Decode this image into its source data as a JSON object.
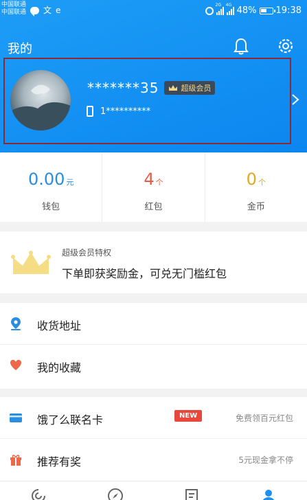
{
  "status_bar": {
    "carrier_1": "中国联通",
    "carrier_2": "中国联通",
    "net_tag_1": "2G",
    "net_tag_2": "4G",
    "battery": "48%",
    "time": "19:38"
  },
  "header": {
    "title": "我的",
    "icons": [
      "bell-icon",
      "settings-icon"
    ]
  },
  "profile": {
    "username": "*******35",
    "vip_badge": "超级会员",
    "phone": "1**********"
  },
  "stats": [
    {
      "value": "0.00",
      "unit": "元",
      "label": "钱包",
      "color": "#2a8de0"
    },
    {
      "value": "4",
      "unit": "个",
      "label": "红包",
      "color": "#e35e4a"
    },
    {
      "value": "0",
      "unit": "个",
      "label": "金币",
      "color": "#e2a820"
    }
  ],
  "vip_card": {
    "title": "超级会员特权",
    "desc": "下单即获奖励金，可兑无门槛红包"
  },
  "list_a": [
    {
      "label": "收货地址",
      "icon": "location-pin-icon"
    },
    {
      "label": "我的收藏",
      "icon": "heart-icon"
    }
  ],
  "list_b": [
    {
      "label": "饿了么联名卡",
      "badge": "NEW",
      "right": "免费领百元红包",
      "icon": "card-icon"
    },
    {
      "label": "推荐有奖",
      "right": "5元现金拿不停",
      "icon": "gift-icon"
    }
  ],
  "colors": {
    "header_blue": "#0b86ef",
    "accent_blue": "#2a8de0",
    "accent_red": "#e35e4a",
    "accent_gold": "#e2a820"
  }
}
